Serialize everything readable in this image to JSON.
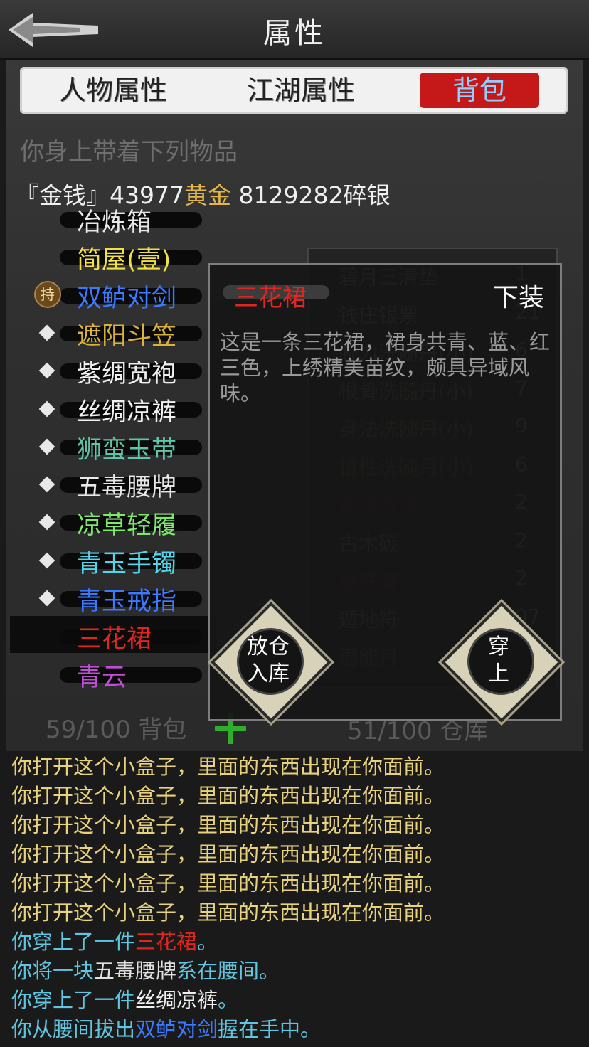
{
  "header": {
    "title": "属性"
  },
  "tabs": [
    {
      "label": "人物属性",
      "active": false
    },
    {
      "label": "江湖属性",
      "active": false
    },
    {
      "label": "背包",
      "active": true
    }
  ],
  "bag": {
    "heading": "你身上带着下列物品",
    "money": {
      "prefix": "『金钱』",
      "gold_amount": "43977",
      "gold_unit": "黄金",
      "silver": " 8129282碎银"
    },
    "items": [
      {
        "name": "冶炼箱",
        "color": "#e8e8e8",
        "marker": "none"
      },
      {
        "name": "简屋(壹)",
        "color": "#f0e044",
        "marker": "none"
      },
      {
        "name": "双鲈对剑",
        "color": "#3a7aff",
        "marker": "badge",
        "badge": "持"
      },
      {
        "name": "遮阳斗笠",
        "color": "#d8b338",
        "marker": "diamond"
      },
      {
        "name": "紫绸宽袍",
        "color": "#f0f0f0",
        "marker": "diamond"
      },
      {
        "name": "丝绸凉裤",
        "color": "#f0f0f0",
        "marker": "diamond"
      },
      {
        "name": "狮蛮玉带",
        "color": "#5ec6a8",
        "marker": "diamond"
      },
      {
        "name": "五毒腰牌",
        "color": "#e8e8e8",
        "marker": "diamond"
      },
      {
        "name": "凉草轻履",
        "color": "#7fe86a",
        "marker": "diamond"
      },
      {
        "name": "青玉手镯",
        "color": "#4fd6e8",
        "marker": "diamond"
      },
      {
        "name": "青玉戒指",
        "color": "#3a7aff",
        "marker": "diamond"
      },
      {
        "name": "三花裙",
        "color": "#e0261e",
        "marker": "none",
        "selected": true
      },
      {
        "name": "青云",
        "color": "#c04fd6",
        "marker": "none"
      }
    ],
    "count_text": "59/100 背包",
    "warehouse_text": "51/100 仓库"
  },
  "warehouse": {
    "items": [
      {
        "name": "碧月三清垫",
        "qty": "1",
        "color": "#777777"
      },
      {
        "name": "钱庄银票",
        "qty": "21",
        "color": "#777777"
      },
      {
        "name": "腕力洗髓丹(小)",
        "qty": "6",
        "color": "#777777"
      },
      {
        "name": "根骨洗髓丹(小)",
        "qty": "7",
        "color": "#6a6a5a"
      },
      {
        "name": "身法洗髓丹(小)",
        "qty": "9",
        "color": "#6b5e2c"
      },
      {
        "name": "悟性洗髓丹(小)",
        "qty": "6",
        "color": "#3e5a2c"
      },
      {
        "name": "福禄寿酒",
        "qty": "2",
        "color": "#5a1a14"
      },
      {
        "name": "古木碳",
        "qty": "2",
        "color": "#6a6a6a"
      },
      {
        "name": "融铁煤",
        "qty": "2",
        "color": "#4a2250"
      },
      {
        "name": "遁地符",
        "qty": "97",
        "color": "#6a6a6a"
      },
      {
        "name": "潜能丹",
        "qty": "",
        "color": "#3e5a2c"
      }
    ]
  },
  "popup": {
    "item_name": "三花裙",
    "action": "下装",
    "description": "这是一条三花裙，裙身共青、蓝、红三色，上绣精美苗纹，颇具异域风味。",
    "store_button": [
      "放仓",
      "入库"
    ],
    "wear_button": [
      "穿",
      "上"
    ]
  },
  "log": [
    [
      {
        "t": "你打开这个小盒子，里面的东西出现在你面前。",
        "c": "#e9d37a"
      }
    ],
    [
      {
        "t": "你打开这个小盒子，里面的东西出现在你面前。",
        "c": "#e9d37a"
      }
    ],
    [
      {
        "t": "你打开这个小盒子，里面的东西出现在你面前。",
        "c": "#e9d37a"
      }
    ],
    [
      {
        "t": "你打开这个小盒子，里面的东西出现在你面前。",
        "c": "#e9d37a"
      }
    ],
    [
      {
        "t": "你打开这个小盒子，里面的东西出现在你面前。",
        "c": "#e9d37a"
      }
    ],
    [
      {
        "t": "你打开这个小盒子，里面的东西出现在你面前。",
        "c": "#e9d37a"
      }
    ],
    [
      {
        "t": "你穿上了一件",
        "c": "#5ec6e0"
      },
      {
        "t": "三花裙",
        "c": "#e0261e"
      },
      {
        "t": "。",
        "c": "#5ec6e0"
      }
    ],
    [
      {
        "t": "你将一块",
        "c": "#5ec6e0"
      },
      {
        "t": "五毒腰牌",
        "c": "#e0e0e0"
      },
      {
        "t": "系在腰间。",
        "c": "#5ec6e0"
      }
    ],
    [
      {
        "t": "你穿上了一件",
        "c": "#5ec6e0"
      },
      {
        "t": "丝绸凉裤",
        "c": "#f0f0f0"
      },
      {
        "t": "。",
        "c": "#5ec6e0"
      }
    ],
    [
      {
        "t": "你从腰间拔出",
        "c": "#5ec6e0"
      },
      {
        "t": "双鲈对剑",
        "c": "#3a7aff"
      },
      {
        "t": "握在手中。",
        "c": "#5ec6e0"
      }
    ]
  ]
}
